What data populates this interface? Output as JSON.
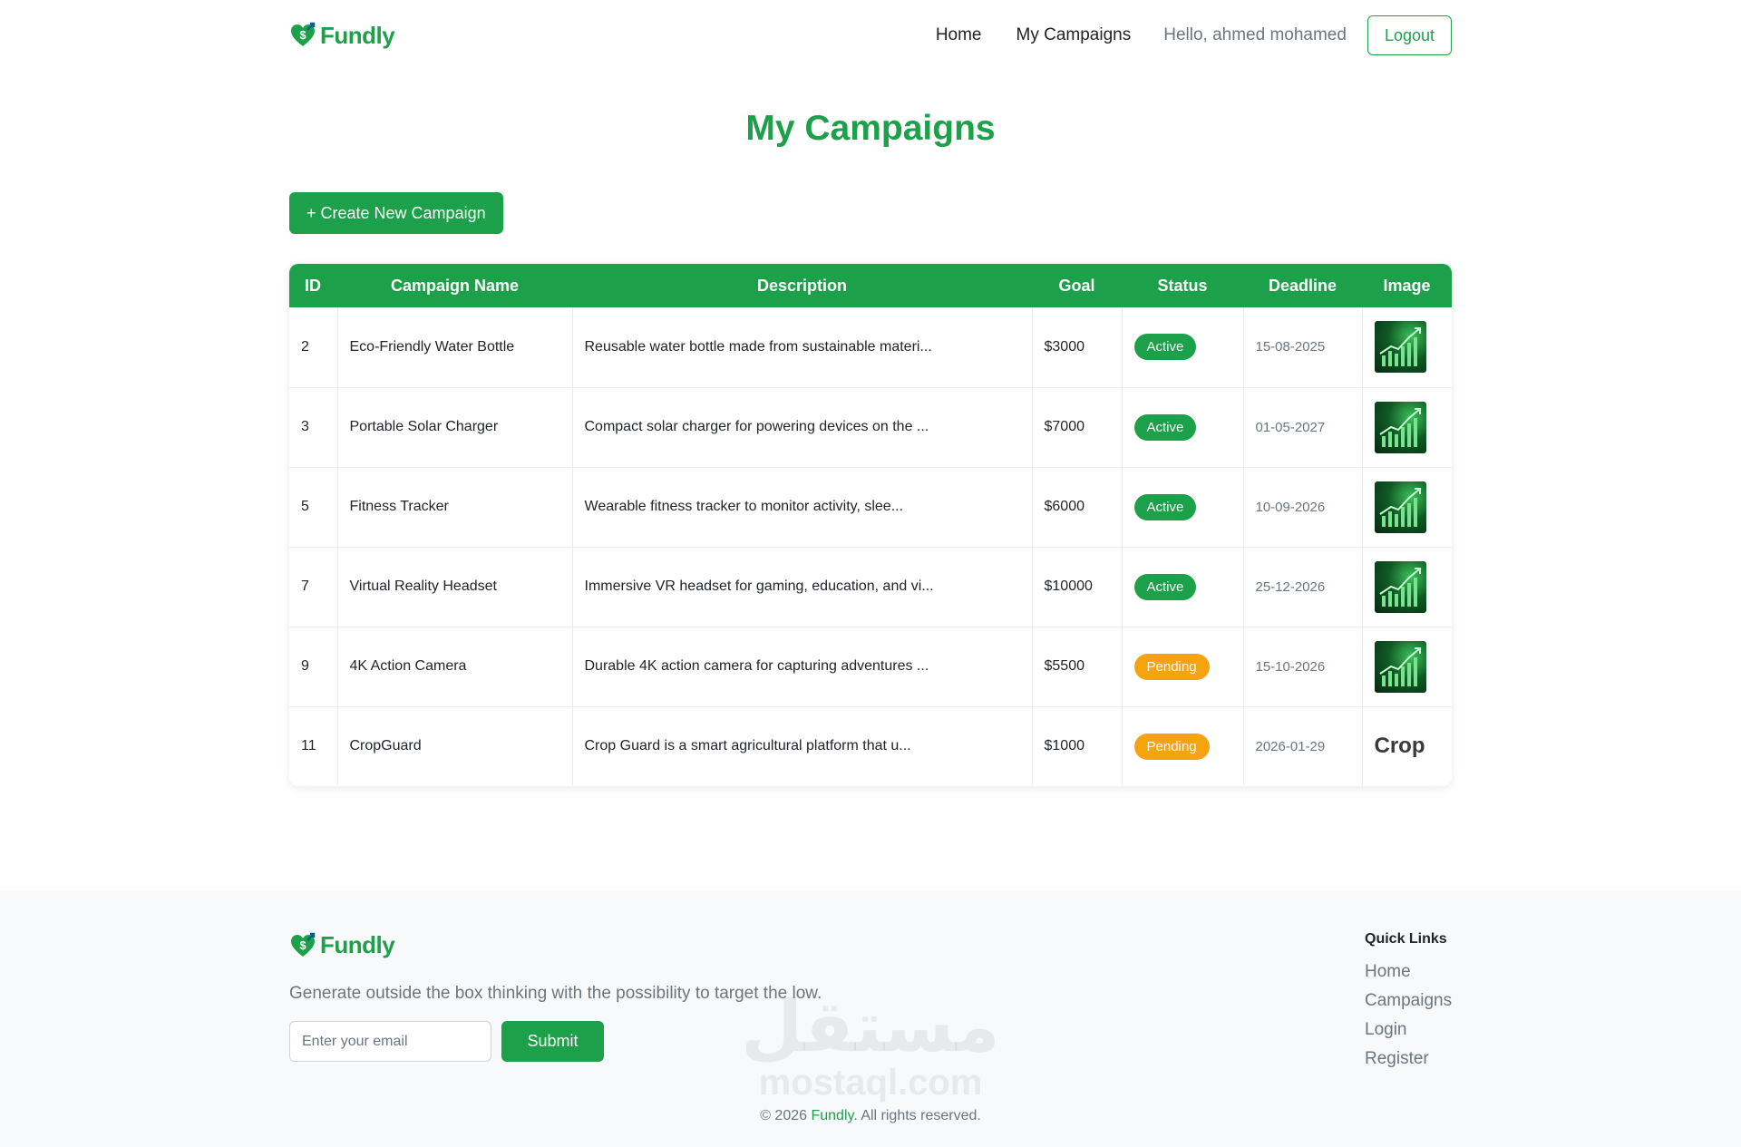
{
  "brand": {
    "name": "Fundly",
    "color": "#1da04a"
  },
  "nav": {
    "home": "Home",
    "my_campaigns": "My Campaigns",
    "greeting": "Hello, ahmed mohamed",
    "logout": "Logout"
  },
  "page": {
    "title": "My Campaigns",
    "create_button": "+ Create New Campaign"
  },
  "table": {
    "headers": {
      "id": "ID",
      "name": "Campaign Name",
      "description": "Description",
      "goal": "Goal",
      "status": "Status",
      "deadline": "Deadline",
      "image": "Image"
    },
    "rows": [
      {
        "id": "2",
        "name": "Eco-Friendly Water Bottle",
        "description": "Reusable water bottle made from sustainable materi...",
        "goal": "$3000",
        "status": "Active",
        "deadline": "15-08-2025",
        "image": "growth-chart-thumbnail"
      },
      {
        "id": "3",
        "name": "Portable Solar Charger",
        "description": "Compact solar charger for powering devices on the ...",
        "goal": "$7000",
        "status": "Active",
        "deadline": "01-05-2027",
        "image": "growth-chart-thumbnail"
      },
      {
        "id": "5",
        "name": "Fitness Tracker",
        "description": "Wearable fitness tracker to monitor activity, slee...",
        "goal": "$6000",
        "status": "Active",
        "deadline": "10-09-2026",
        "image": "growth-chart-thumbnail"
      },
      {
        "id": "7",
        "name": "Virtual Reality Headset",
        "description": "Immersive VR headset for gaming, education, and vi...",
        "goal": "$10000",
        "status": "Active",
        "deadline": "25-12-2026",
        "image": "growth-chart-thumbnail"
      },
      {
        "id": "9",
        "name": "4K Action Camera",
        "description": "Durable 4K action camera for capturing adventures ...",
        "goal": "$5500",
        "status": "Pending",
        "deadline": "15-10-2026",
        "image": "growth-chart-thumbnail"
      },
      {
        "id": "11",
        "name": "CropGuard",
        "description": "Crop Guard is a smart agricultural platform that u...",
        "goal": "$1000",
        "status": "Pending",
        "deadline": "2026-01-29",
        "image": "Crop"
      }
    ],
    "status_colors": {
      "Active": "#1da04a",
      "Pending": "#f5a30f"
    }
  },
  "footer": {
    "tagline": "Generate outside the box thinking with the possibility to target the low.",
    "email_placeholder": "Enter your email",
    "submit": "Submit",
    "quick_links_title": "Quick Links",
    "quick_links": [
      "Home",
      "Campaigns",
      "Login",
      "Register"
    ],
    "copyright_prefix": "© 2026 ",
    "copyright_brand": "Fundly",
    "copyright_suffix": ". All rights reserved.",
    "watermark": "مستقل",
    "watermark_sub": "mostaql.com"
  }
}
